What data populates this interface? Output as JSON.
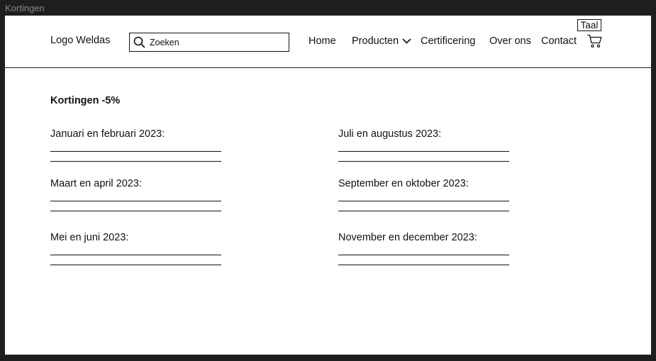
{
  "window": {
    "title": "Kortingen"
  },
  "header": {
    "logo": "Logo Weldas",
    "search": {
      "placeholder": "Zoeken",
      "value": ""
    },
    "nav": {
      "home": "Home",
      "producten": "Producten",
      "certificering": "Certificering",
      "over_ons": "Over ons",
      "contact": "Contact"
    },
    "language": "Taal",
    "icons": {
      "search": "search-icon",
      "dropdown": "chevron-down-icon",
      "cart": "cart-icon"
    }
  },
  "main": {
    "title": "Kortingen -5%",
    "periods": [
      {
        "label": "Januari en februari 2023:"
      },
      {
        "label": "Maart en april 2023:"
      },
      {
        "label": "Mei en juni 2023:"
      },
      {
        "label": "Juli en augustus 2023:"
      },
      {
        "label": "September en oktober 2023:"
      },
      {
        "label": "November en december 2023:"
      }
    ]
  }
}
